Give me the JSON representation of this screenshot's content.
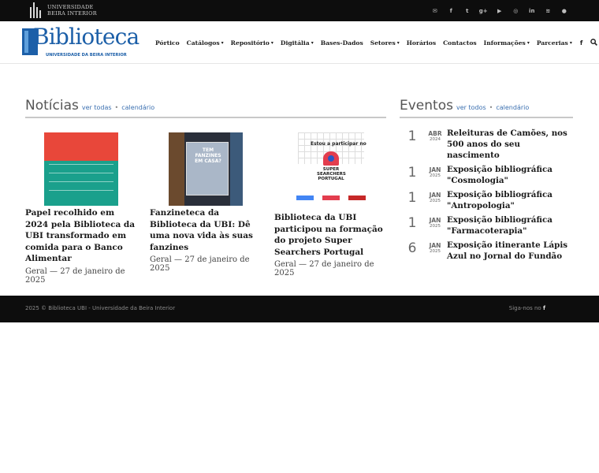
{
  "topbar": {
    "org_line1": "UNIVERSIDADE",
    "org_line2": "BEIRA INTERIOR",
    "social_icons": [
      "email-icon",
      "facebook-icon",
      "twitter-icon",
      "google-plus-icon",
      "youtube-icon",
      "instagram-icon",
      "linkedin-icon",
      "rss-icon",
      "user-icon"
    ],
    "social_glyphs": [
      "✉",
      "f",
      "t",
      "g+",
      "▶",
      "◎",
      "in",
      "≋",
      "●"
    ]
  },
  "header": {
    "brand_name": "Biblioteca",
    "brand_sub": "UNIVERSIDADE DA BEIRA INTERIOR",
    "nav": [
      {
        "label": "Pórtico",
        "dropdown": false
      },
      {
        "label": "Catálogos",
        "dropdown": true
      },
      {
        "label": "Repositório",
        "dropdown": true
      },
      {
        "label": "Digitália",
        "dropdown": true
      },
      {
        "label": "Bases-Dados",
        "dropdown": false
      },
      {
        "label": "Setores",
        "dropdown": true
      },
      {
        "label": "Horários",
        "dropdown": false
      },
      {
        "label": "Contactos",
        "dropdown": false
      },
      {
        "label": "Informações",
        "dropdown": true
      },
      {
        "label": "Parcerias",
        "dropdown": true
      }
    ],
    "facebook_glyph": "f",
    "search_glyph": "🔍"
  },
  "news": {
    "title": "Notícias",
    "link_all": "ver todas",
    "link_calendar": "calendário",
    "items": [
      {
        "title": "Papel recolhido em 2024 pela Biblioteca da UBI transformado em comida para o Banco Alimentar",
        "category": "Geral",
        "date": "27 de janeiro de 2025"
      },
      {
        "title": "Fanzineteca da Biblioteca da UBI: Dê uma nova vida às suas fanzines",
        "category": "Geral",
        "date": "27 de janeiro de 2025",
        "image_text": "TEM FANZINES EM CASA?"
      },
      {
        "title": "Biblioteca da UBI participou na formação do projeto Super Searchers Portugal",
        "category": "Geral",
        "date": "27 de janeiro de 2025",
        "image_text": "Estou a participar no",
        "image_sub": "SUPER SEARCHERS PORTUGAL"
      }
    ]
  },
  "events": {
    "title": "Eventos",
    "link_all": "ver todos",
    "link_calendar": "calendário",
    "items": [
      {
        "day": "1",
        "month": "ABR",
        "year": "2024",
        "title": "Releituras de Camões, nos 500 anos do seu nascimento"
      },
      {
        "day": "1",
        "month": "JAN",
        "year": "2025",
        "title": "Exposição bibliográfica \"Cosmologia\""
      },
      {
        "day": "1",
        "month": "JAN",
        "year": "2025",
        "title": "Exposição bibliográfica \"Antropologia\""
      },
      {
        "day": "1",
        "month": "JAN",
        "year": "2025",
        "title": "Exposição bibliográfica \"Farmacoterapia\""
      },
      {
        "day": "6",
        "month": "JAN",
        "year": "2025",
        "title": "Exposição itinerante Lápis Azul no Jornal do Fundão"
      }
    ]
  },
  "footer": {
    "copyright": "2025 © Biblioteca UBI - Universidade da Beira Interior",
    "follow": "Siga-nos no",
    "follow_glyph": "f"
  }
}
